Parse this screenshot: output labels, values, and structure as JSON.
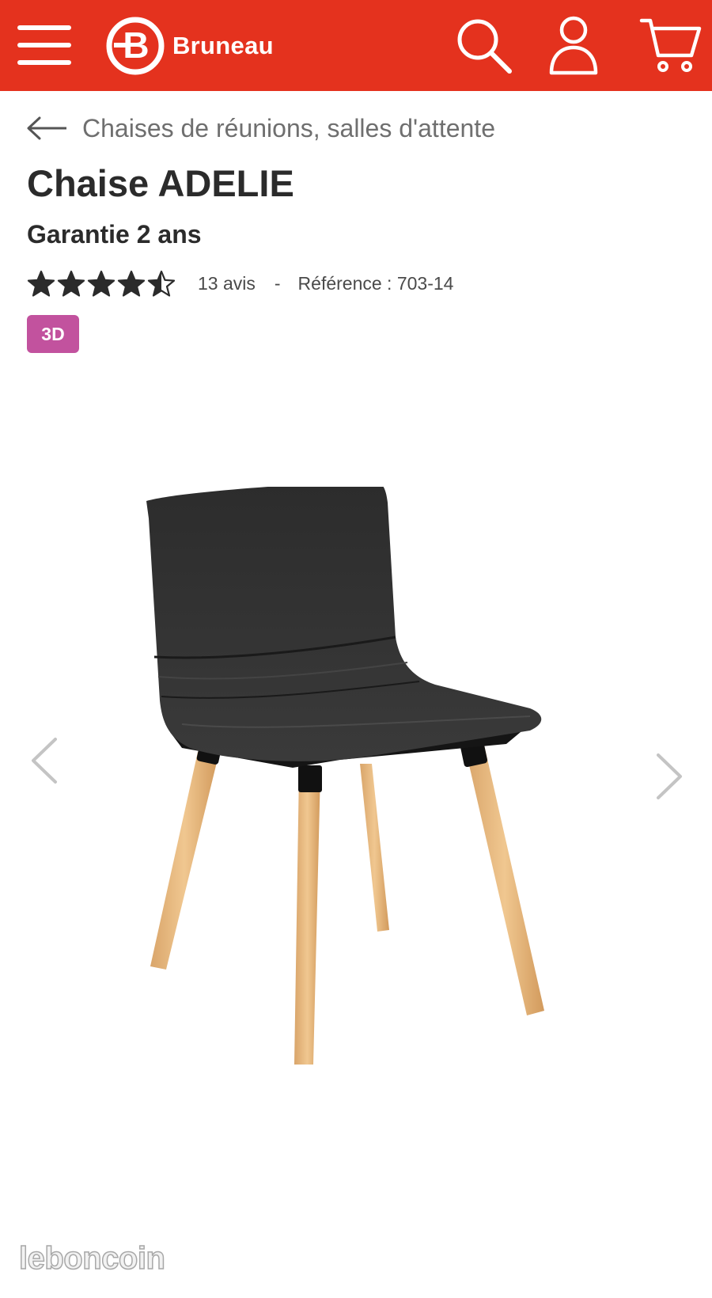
{
  "header": {
    "brand": "Bruneau",
    "brand_color": "#e4321e",
    "icons": [
      "menu-icon",
      "logo-b-icon",
      "search-icon",
      "user-icon",
      "cart-icon"
    ]
  },
  "breadcrumb": {
    "back_label": "Chaises de réunions, salles d'attente"
  },
  "product": {
    "title": "Chaise ADELIE",
    "warranty": "Garantie 2 ans",
    "rating_value": 4.5,
    "rating_max": 5,
    "reviews": "13 avis",
    "separator": "-",
    "reference": "Référence : 703-14",
    "badge_3d": "3D",
    "badge_color": "#c2529e"
  },
  "gallery": {
    "icons": [
      "chevron-left-icon",
      "chevron-right-icon"
    ]
  },
  "watermark": {
    "text": "leboncoin"
  }
}
